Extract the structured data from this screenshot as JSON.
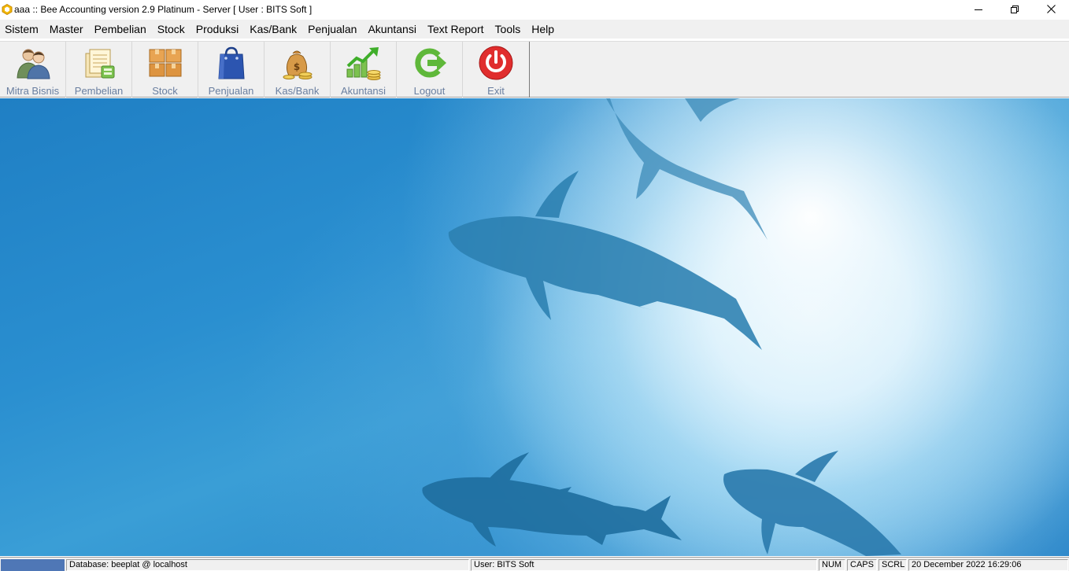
{
  "titlebar": {
    "title": "aaa :: Bee Accounting version 2.9 Platinum - Server  [ User : BITS Soft ]"
  },
  "menu": [
    {
      "label": "Sistem"
    },
    {
      "label": "Master"
    },
    {
      "label": "Pembelian"
    },
    {
      "label": "Stock"
    },
    {
      "label": "Produksi"
    },
    {
      "label": "Kas/Bank"
    },
    {
      "label": "Penjualan"
    },
    {
      "label": "Akuntansi"
    },
    {
      "label": "Text Report"
    },
    {
      "label": "Tools"
    },
    {
      "label": "Help"
    }
  ],
  "toolbar": {
    "buttons": [
      {
        "label": "Mitra Bisnis",
        "icon": "business-partners-icon"
      },
      {
        "label": "Pembelian",
        "icon": "purchase-documents-icon"
      },
      {
        "label": "Stock",
        "icon": "stock-boxes-icon"
      },
      {
        "label": "Penjualan",
        "icon": "shopping-bag-icon"
      },
      {
        "label": "Kas/Bank",
        "icon": "money-bag-icon"
      },
      {
        "label": "Akuntansi",
        "icon": "growth-chart-icon"
      },
      {
        "label": "Logout",
        "icon": "logout-arrow-icon"
      },
      {
        "label": "Exit",
        "icon": "power-icon"
      }
    ]
  },
  "statusbar": {
    "database": "Database: beeplat @ localhost",
    "user": "User: BITS Soft",
    "num": "NUM",
    "caps": "CAPS",
    "scrl": "SCRL",
    "datetime": "20 December 2022  16:29:06"
  },
  "colors": {
    "toolbar_label": "#6a7fa0",
    "progress": "#4f77b6",
    "wallpaper_deep": "#1f7fc4",
    "wallpaper_light": "#e8f6fd"
  }
}
